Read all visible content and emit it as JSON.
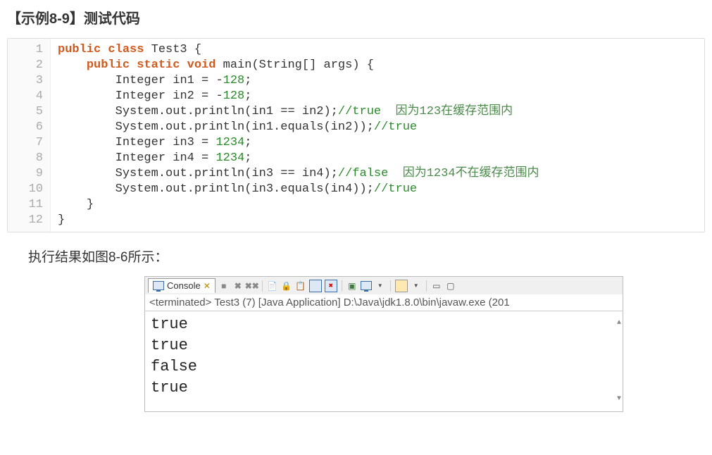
{
  "title": "【示例8-9】测试代码",
  "code": {
    "line_count": 12,
    "lines": [
      {
        "indent": 0,
        "tokens": [
          {
            "t": "kw-pc",
            "v": "public class "
          },
          {
            "t": "",
            "v": "Test3 "
          },
          {
            "t": "brace",
            "v": "{"
          }
        ]
      },
      {
        "indent": 1,
        "tokens": [
          {
            "t": "kw-psv",
            "v": "public static void "
          },
          {
            "t": "",
            "v": "main"
          },
          {
            "t": "paren",
            "v": "("
          },
          {
            "t": "",
            "v": "String"
          },
          {
            "t": "paren",
            "v": "[]"
          },
          {
            "t": "",
            "v": " args"
          },
          {
            "t": "paren",
            "v": ")"
          },
          {
            "t": "",
            "v": " "
          },
          {
            "t": "brace",
            "v": "{"
          }
        ]
      },
      {
        "indent": 2,
        "tokens": [
          {
            "t": "",
            "v": "Integer in1 = -"
          },
          {
            "t": "num",
            "v": "128"
          },
          {
            "t": "",
            "v": ";"
          }
        ]
      },
      {
        "indent": 2,
        "tokens": [
          {
            "t": "",
            "v": "Integer in2 = -"
          },
          {
            "t": "num",
            "v": "128"
          },
          {
            "t": "",
            "v": ";"
          }
        ]
      },
      {
        "indent": 2,
        "tokens": [
          {
            "t": "",
            "v": "System.out.println(in1 == in2);"
          },
          {
            "t": "cmt",
            "v": "//true"
          },
          {
            "t": "cmt-cn",
            "v": "  因为123在缓存范围内"
          }
        ]
      },
      {
        "indent": 2,
        "tokens": [
          {
            "t": "",
            "v": "System.out.println(in1.equals(in2));"
          },
          {
            "t": "cmt",
            "v": "//true"
          }
        ]
      },
      {
        "indent": 2,
        "tokens": [
          {
            "t": "",
            "v": "Integer in3 = "
          },
          {
            "t": "num",
            "v": "1234"
          },
          {
            "t": "",
            "v": ";"
          }
        ]
      },
      {
        "indent": 2,
        "tokens": [
          {
            "t": "",
            "v": "Integer in4 = "
          },
          {
            "t": "num",
            "v": "1234"
          },
          {
            "t": "",
            "v": ";"
          }
        ]
      },
      {
        "indent": 2,
        "tokens": [
          {
            "t": "",
            "v": "System.out.println(in3 == in4);"
          },
          {
            "t": "cmt",
            "v": "//false"
          },
          {
            "t": "cmt-cn",
            "v": "  因为1234不在缓存范围内"
          }
        ]
      },
      {
        "indent": 2,
        "tokens": [
          {
            "t": "",
            "v": "System.out.println(in3.equals(in4));"
          },
          {
            "t": "cmt",
            "v": "//true"
          }
        ]
      },
      {
        "indent": 1,
        "tokens": [
          {
            "t": "brace",
            "v": "}"
          }
        ]
      },
      {
        "indent": 0,
        "tokens": [
          {
            "t": "brace",
            "v": "}"
          }
        ]
      }
    ]
  },
  "result_intro": "执行结果如图8-6所示：",
  "console": {
    "tab_label": "Console",
    "tab_close": "✕",
    "term_line": "<terminated> Test3 (7) [Java Application] D:\\Java\\jdk1.8.0\\bin\\javaw.exe (201",
    "output": [
      "true",
      "true",
      "false",
      "true"
    ],
    "toolbar_icons": [
      "stop",
      "remove",
      "remove-all",
      "sep",
      "scroll-lock",
      "pin",
      "clear",
      "toggle1",
      "toggle2",
      "sep",
      "open",
      "monitor",
      "dd",
      "sep",
      "new",
      "dd",
      "sep",
      "min",
      "max"
    ]
  }
}
